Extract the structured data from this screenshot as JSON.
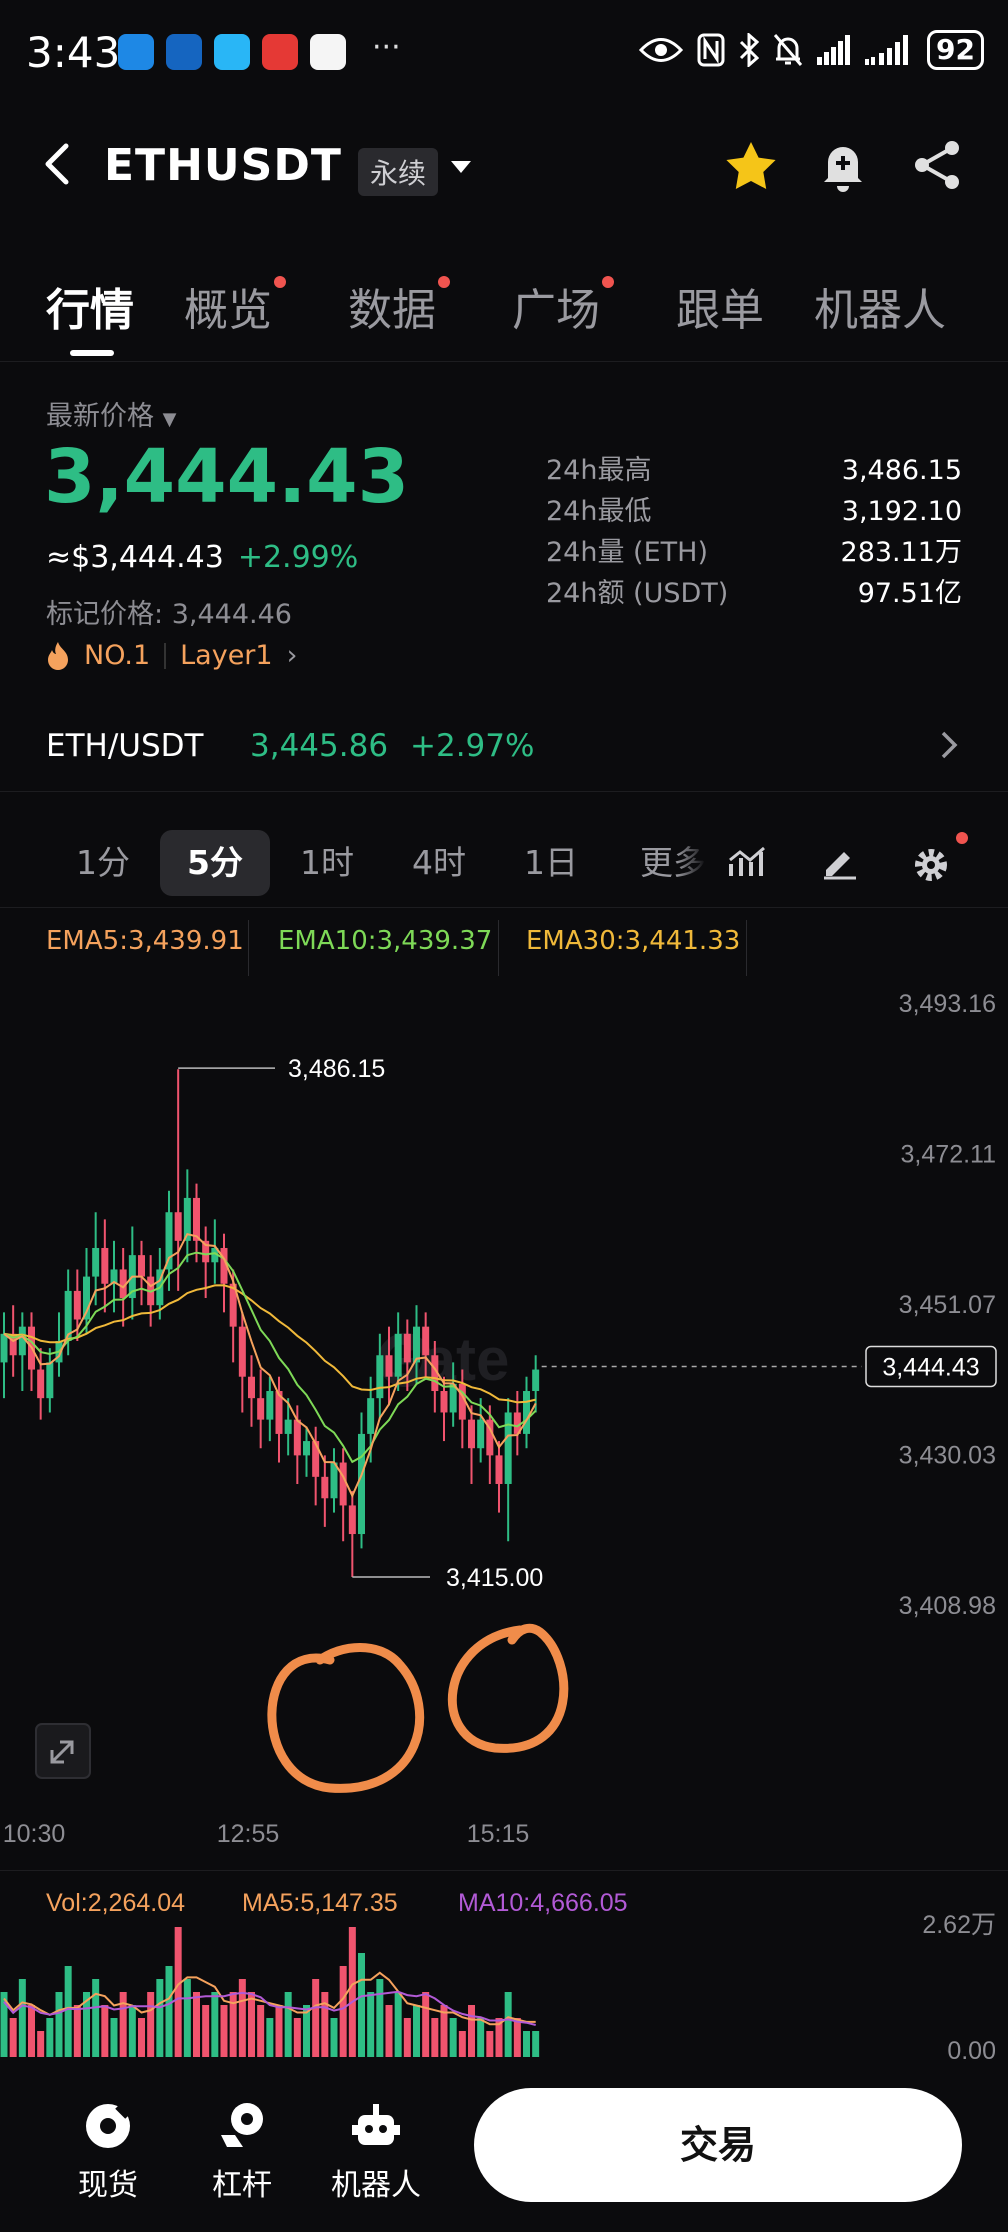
{
  "status": {
    "time": "3:43",
    "more": "···",
    "battery": "92",
    "app_icon_colors": [
      "#1e88e5",
      "#1565c0",
      "#29b6f6",
      "#e53935",
      "#f5f5f5"
    ]
  },
  "header": {
    "symbol": "ETHUSDT",
    "contract_type": "永续",
    "icons": [
      "back-icon",
      "chevron-down-icon",
      "star-icon",
      "bell-plus-icon",
      "share-icon"
    ]
  },
  "tabs": [
    {
      "label": "行情",
      "active": true,
      "dot": false
    },
    {
      "label": "概览",
      "active": false,
      "dot": true
    },
    {
      "label": "数据",
      "active": false,
      "dot": true
    },
    {
      "label": "广场",
      "active": false,
      "dot": true
    },
    {
      "label": "跟单",
      "active": false,
      "dot": false
    },
    {
      "label": "机器人",
      "active": false,
      "dot": false
    }
  ],
  "price": {
    "label": "最新价格",
    "last": "3,444.43",
    "usd": "≈$3,444.43",
    "change": "+2.99%",
    "mark_label": "标记价格:",
    "mark": "3,444.46",
    "rank": "NO.1",
    "sector": "Layer1"
  },
  "stats": [
    {
      "k": "24h最高",
      "v": "3,486.15"
    },
    {
      "k": "24h最低",
      "v": "3,192.10"
    },
    {
      "k": "24h量 (ETH)",
      "v": "283.11万"
    },
    {
      "k": "24h额 (USDT)",
      "v": "97.51亿"
    }
  ],
  "spot": {
    "pair": "ETH/USDT",
    "price": "3,445.86",
    "change": "+2.97%"
  },
  "intervals": [
    {
      "label": "1分",
      "active": false
    },
    {
      "label": "5分",
      "active": true
    },
    {
      "label": "1时",
      "active": false
    },
    {
      "label": "4时",
      "active": false
    },
    {
      "label": "1日",
      "active": false
    }
  ],
  "interval_more": "更多",
  "ema": {
    "ema5": "EMA5:3,439.91",
    "ema10": "EMA10:3,439.37",
    "ema30": "EMA30:3,441.33"
  },
  "chart_data": {
    "type": "candlestick",
    "y_ticks": [
      "3,493.16",
      "3,472.11",
      "3,451.07",
      "3,430.03",
      "3,408.98"
    ],
    "x_ticks": [
      "10:30",
      "12:55",
      "15:15"
    ],
    "ylim": [
      3408.98,
      3493.16
    ],
    "high_label": "3,486.15",
    "low_label": "3,415.00",
    "current_label": "3,444.43",
    "watermark": "Gate",
    "colors": {
      "up": "#2ebd85",
      "down": "#f0546e",
      "ema5": "#f5a25d",
      "ema10": "#7ed957",
      "ema30": "#f0b93a"
    },
    "candles": [
      [
        3445,
        3449,
        3440,
        3452
      ],
      [
        3449,
        3446,
        3443,
        3453
      ],
      [
        3446,
        3450,
        3441,
        3452
      ],
      [
        3450,
        3444,
        3441,
        3452
      ],
      [
        3444,
        3440,
        3437,
        3447
      ],
      [
        3440,
        3445,
        3438,
        3447
      ],
      [
        3445,
        3448,
        3443,
        3452
      ],
      [
        3448,
        3455,
        3446,
        3458
      ],
      [
        3455,
        3451,
        3448,
        3458
      ],
      [
        3451,
        3457,
        3449,
        3461
      ],
      [
        3457,
        3461,
        3453,
        3466
      ],
      [
        3461,
        3456,
        3452,
        3465
      ],
      [
        3456,
        3458,
        3452,
        3462
      ],
      [
        3458,
        3454,
        3450,
        3461
      ],
      [
        3454,
        3460,
        3451,
        3464
      ],
      [
        3460,
        3457,
        3453,
        3462
      ],
      [
        3457,
        3453,
        3450,
        3460
      ],
      [
        3453,
        3458,
        3451,
        3461
      ],
      [
        3458,
        3466,
        3455,
        3469
      ],
      [
        3466,
        3462,
        3455,
        3486
      ],
      [
        3462,
        3468,
        3459,
        3472
      ],
      [
        3468,
        3462,
        3459,
        3470
      ],
      [
        3462,
        3459,
        3454,
        3464
      ],
      [
        3459,
        3461,
        3456,
        3465
      ],
      [
        3461,
        3456,
        3452,
        3463
      ],
      [
        3456,
        3450,
        3445,
        3458
      ],
      [
        3450,
        3443,
        3438,
        3452
      ],
      [
        3443,
        3440,
        3436,
        3446
      ],
      [
        3440,
        3437,
        3433,
        3444
      ],
      [
        3437,
        3441,
        3434,
        3443
      ],
      [
        3441,
        3435,
        3431,
        3443
      ],
      [
        3435,
        3437,
        3432,
        3440
      ],
      [
        3437,
        3432,
        3428,
        3439
      ],
      [
        3432,
        3434,
        3429,
        3436
      ],
      [
        3434,
        3429,
        3425,
        3436
      ],
      [
        3429,
        3426,
        3422,
        3432
      ],
      [
        3426,
        3431,
        3424,
        3433
      ],
      [
        3431,
        3425,
        3420,
        3433
      ],
      [
        3425,
        3421,
        3415,
        3427
      ],
      [
        3421,
        3435,
        3419,
        3438
      ],
      [
        3435,
        3440,
        3431,
        3443
      ],
      [
        3440,
        3446,
        3437,
        3449
      ],
      [
        3446,
        3443,
        3439,
        3450
      ],
      [
        3443,
        3449,
        3441,
        3452
      ],
      [
        3449,
        3445,
        3441,
        3451
      ],
      [
        3445,
        3450,
        3442,
        3453
      ],
      [
        3450,
        3446,
        3443,
        3452
      ],
      [
        3446,
        3441,
        3438,
        3448
      ],
      [
        3441,
        3438,
        3434,
        3443
      ],
      [
        3438,
        3442,
        3436,
        3445
      ],
      [
        3442,
        3437,
        3433,
        3444
      ],
      [
        3437,
        3433,
        3428,
        3439
      ],
      [
        3433,
        3437,
        3431,
        3440
      ],
      [
        3437,
        3432,
        3428,
        3439
      ],
      [
        3432,
        3428,
        3424,
        3434
      ],
      [
        3428,
        3438,
        3420,
        3440
      ],
      [
        3438,
        3435,
        3432,
        3441
      ],
      [
        3435,
        3441,
        3433,
        3443
      ],
      [
        3441,
        3444,
        3438,
        3446
      ]
    ]
  },
  "volume": {
    "vol": "Vol:2,264.04",
    "ma5": "MA5:5,147.35",
    "ma10": "MA10:4,666.05",
    "top": "2.62万",
    "bottom": "0.00",
    "bars": [
      0.5,
      0.3,
      0.6,
      0.4,
      0.2,
      0.3,
      0.5,
      0.7,
      0.4,
      0.5,
      0.6,
      0.4,
      0.3,
      0.5,
      0.4,
      0.3,
      0.5,
      0.6,
      0.7,
      1.0,
      0.6,
      0.5,
      0.4,
      0.5,
      0.4,
      0.5,
      0.6,
      0.5,
      0.4,
      0.3,
      0.4,
      0.5,
      0.3,
      0.4,
      0.6,
      0.5,
      0.3,
      0.7,
      1.0,
      0.8,
      0.5,
      0.6,
      0.4,
      0.5,
      0.3,
      0.4,
      0.5,
      0.3,
      0.4,
      0.3,
      0.2,
      0.4,
      0.3,
      0.2,
      0.3,
      0.5,
      0.3,
      0.2,
      0.2
    ]
  },
  "bottom_nav": [
    {
      "label": "现货",
      "icon": "spot-icon"
    },
    {
      "label": "杠杆",
      "icon": "leverage-icon"
    },
    {
      "label": "机器人",
      "icon": "robot-icon"
    }
  ],
  "trade_button": "交易"
}
